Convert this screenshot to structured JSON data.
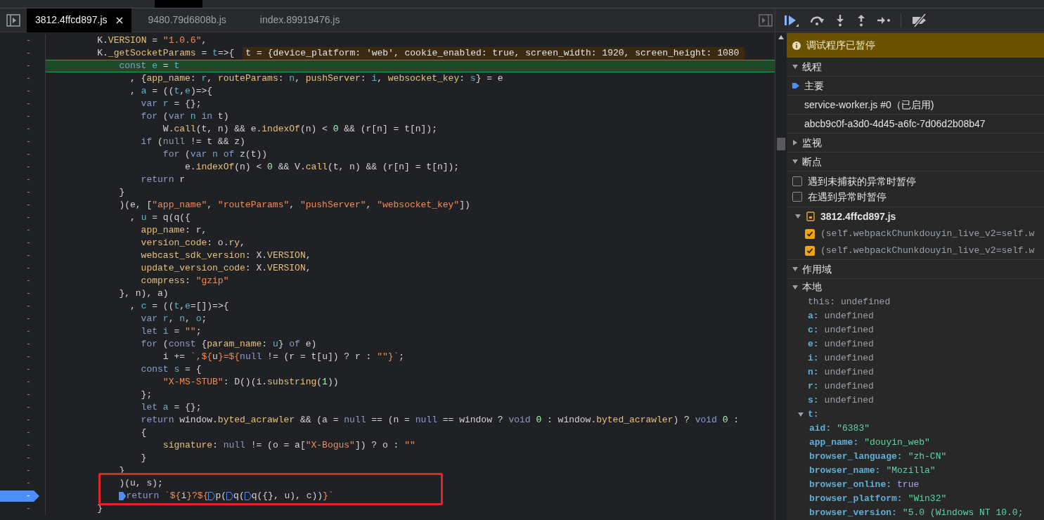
{
  "file_tabs": [
    {
      "label": "3812.4ffcd897.js",
      "selected": true,
      "closable": true
    },
    {
      "label": "9480.79d6808b.js",
      "selected": false,
      "closable": false
    },
    {
      "label": "index.89919476.js",
      "selected": false,
      "closable": false
    }
  ],
  "code": {
    "lines": [
      {
        "gutter": "-",
        "tokens": [
          {
            "text": "         K.",
            "kind": "plain"
          },
          {
            "text": "VERSION",
            "kind": "property"
          },
          {
            "text": " = ",
            "kind": "plain"
          },
          {
            "text": "\"1.0.6\"",
            "kind": "string"
          },
          {
            "text": ",",
            "kind": "plain"
          }
        ]
      },
      {
        "gutter": "-",
        "tokens": [
          {
            "text": "         K.",
            "kind": "plain"
          },
          {
            "text": "_getSocketParams",
            "kind": "property"
          },
          {
            "text": " = ",
            "kind": "plain"
          },
          {
            "text": "t",
            "kind": "variable"
          },
          {
            "text": "=>{",
            "kind": "plain"
          }
        ],
        "inline_value": "t = {device_platform: 'web', cookie_enabled: true, screen_width: 1920, screen_height: 1080"
      },
      {
        "gutter": "-",
        "current": true,
        "tokens": [
          {
            "text": "             const",
            "kind": "keyword"
          },
          {
            "text": " e",
            "kind": "variable"
          },
          {
            "text": " = ",
            "kind": "plain"
          },
          {
            "text": "t",
            "kind": "variable"
          }
        ]
      },
      {
        "gutter": "-",
        "tokens": [
          {
            "text": "               , {",
            "kind": "plain"
          },
          {
            "text": "app_name",
            "kind": "property"
          },
          {
            "text": ": ",
            "kind": "plain"
          },
          {
            "text": "r",
            "kind": "variable"
          },
          {
            "text": ", ",
            "kind": "plain"
          },
          {
            "text": "routeParams",
            "kind": "property"
          },
          {
            "text": ": ",
            "kind": "plain"
          },
          {
            "text": "n",
            "kind": "variable"
          },
          {
            "text": ", ",
            "kind": "plain"
          },
          {
            "text": "pushServer",
            "kind": "property"
          },
          {
            "text": ": ",
            "kind": "plain"
          },
          {
            "text": "i",
            "kind": "variable"
          },
          {
            "text": ", ",
            "kind": "plain"
          },
          {
            "text": "websocket_key",
            "kind": "property"
          },
          {
            "text": ": ",
            "kind": "plain"
          },
          {
            "text": "s",
            "kind": "variable"
          },
          {
            "text": "} = e",
            "kind": "plain"
          }
        ]
      },
      {
        "gutter": "-",
        "tokens": [
          {
            "text": "               , ",
            "kind": "plain"
          },
          {
            "text": "a",
            "kind": "variable"
          },
          {
            "text": " = ((",
            "kind": "plain"
          },
          {
            "text": "t",
            "kind": "variable"
          },
          {
            "text": ",",
            "kind": "plain"
          },
          {
            "text": "e",
            "kind": "variable"
          },
          {
            "text": ")=>{",
            "kind": "plain"
          }
        ]
      },
      {
        "gutter": "-",
        "tokens": [
          {
            "text": "                 var",
            "kind": "keyword"
          },
          {
            "text": " r",
            "kind": "variable"
          },
          {
            "text": " = {};",
            "kind": "plain"
          }
        ]
      },
      {
        "gutter": "-",
        "tokens": [
          {
            "text": "                 for",
            "kind": "keyword"
          },
          {
            "text": " (",
            "kind": "plain"
          },
          {
            "text": "var",
            "kind": "keyword"
          },
          {
            "text": " n",
            "kind": "variable"
          },
          {
            "text": " in",
            "kind": "keyword"
          },
          {
            "text": " t)",
            "kind": "plain"
          }
        ]
      },
      {
        "gutter": "-",
        "tokens": [
          {
            "text": "                     W.",
            "kind": "plain"
          },
          {
            "text": "call",
            "kind": "property"
          },
          {
            "text": "(t, n) && e.",
            "kind": "plain"
          },
          {
            "text": "indexOf",
            "kind": "property"
          },
          {
            "text": "(n) < ",
            "kind": "plain"
          },
          {
            "text": "0",
            "kind": "number"
          },
          {
            "text": " && (r[n] = t[n]);",
            "kind": "plain"
          }
        ]
      },
      {
        "gutter": "-",
        "tokens": [
          {
            "text": "                 if",
            "kind": "keyword"
          },
          {
            "text": " (",
            "kind": "plain"
          },
          {
            "text": "null",
            "kind": "keyword"
          },
          {
            "text": " != t && z)",
            "kind": "plain"
          }
        ]
      },
      {
        "gutter": "-",
        "tokens": [
          {
            "text": "                     for",
            "kind": "keyword"
          },
          {
            "text": " (",
            "kind": "plain"
          },
          {
            "text": "var",
            "kind": "keyword"
          },
          {
            "text": " n",
            "kind": "variable"
          },
          {
            "text": " of",
            "kind": "keyword"
          },
          {
            "text": " z(t))",
            "kind": "plain"
          }
        ]
      },
      {
        "gutter": "-",
        "tokens": [
          {
            "text": "                         e.",
            "kind": "plain"
          },
          {
            "text": "indexOf",
            "kind": "property"
          },
          {
            "text": "(n) < ",
            "kind": "plain"
          },
          {
            "text": "0",
            "kind": "number"
          },
          {
            "text": " && V.",
            "kind": "plain"
          },
          {
            "text": "call",
            "kind": "property"
          },
          {
            "text": "(t, n) && (r[n] = t[n]);",
            "kind": "plain"
          }
        ]
      },
      {
        "gutter": "-",
        "tokens": [
          {
            "text": "                 return",
            "kind": "keyword"
          },
          {
            "text": " r",
            "kind": "plain"
          }
        ]
      },
      {
        "gutter": "-",
        "tokens": [
          {
            "text": "             }",
            "kind": "plain"
          }
        ]
      },
      {
        "gutter": "-",
        "tokens": [
          {
            "text": "             )(e, [",
            "kind": "plain"
          },
          {
            "text": "\"app_name\"",
            "kind": "string"
          },
          {
            "text": ", ",
            "kind": "plain"
          },
          {
            "text": "\"routeParams\"",
            "kind": "string"
          },
          {
            "text": ", ",
            "kind": "plain"
          },
          {
            "text": "\"pushServer\"",
            "kind": "string"
          },
          {
            "text": ", ",
            "kind": "plain"
          },
          {
            "text": "\"websocket_key\"",
            "kind": "string"
          },
          {
            "text": "])",
            "kind": "plain"
          }
        ]
      },
      {
        "gutter": "-",
        "tokens": [
          {
            "text": "               , ",
            "kind": "plain"
          },
          {
            "text": "u",
            "kind": "variable"
          },
          {
            "text": " = q(q({",
            "kind": "plain"
          }
        ]
      },
      {
        "gutter": "-",
        "tokens": [
          {
            "text": "                 app_name",
            "kind": "property"
          },
          {
            "text": ": r,",
            "kind": "plain"
          }
        ]
      },
      {
        "gutter": "-",
        "tokens": [
          {
            "text": "                 version_code",
            "kind": "property"
          },
          {
            "text": ": o.",
            "kind": "plain"
          },
          {
            "text": "ry",
            "kind": "property"
          },
          {
            "text": ",",
            "kind": "plain"
          }
        ]
      },
      {
        "gutter": "-",
        "tokens": [
          {
            "text": "                 webcast_sdk_version",
            "kind": "property"
          },
          {
            "text": ": X.",
            "kind": "plain"
          },
          {
            "text": "VERSION",
            "kind": "property"
          },
          {
            "text": ",",
            "kind": "plain"
          }
        ]
      },
      {
        "gutter": "-",
        "tokens": [
          {
            "text": "                 update_version_code",
            "kind": "property"
          },
          {
            "text": ": X.",
            "kind": "plain"
          },
          {
            "text": "VERSION",
            "kind": "property"
          },
          {
            "text": ",",
            "kind": "plain"
          }
        ]
      },
      {
        "gutter": "-",
        "tokens": [
          {
            "text": "                 compress",
            "kind": "property"
          },
          {
            "text": ": ",
            "kind": "plain"
          },
          {
            "text": "\"gzip\"",
            "kind": "string"
          }
        ]
      },
      {
        "gutter": "-",
        "tokens": [
          {
            "text": "             }, n), a)",
            "kind": "plain"
          }
        ]
      },
      {
        "gutter": "-",
        "tokens": [
          {
            "text": "               , ",
            "kind": "plain"
          },
          {
            "text": "c",
            "kind": "variable"
          },
          {
            "text": " = ((",
            "kind": "plain"
          },
          {
            "text": "t",
            "kind": "variable"
          },
          {
            "text": ",",
            "kind": "plain"
          },
          {
            "text": "e",
            "kind": "variable"
          },
          {
            "text": "=[])=>{",
            "kind": "plain"
          }
        ]
      },
      {
        "gutter": "-",
        "tokens": [
          {
            "text": "                 var",
            "kind": "keyword"
          },
          {
            "text": " r",
            "kind": "variable"
          },
          {
            "text": ", ",
            "kind": "plain"
          },
          {
            "text": "n",
            "kind": "variable"
          },
          {
            "text": ", ",
            "kind": "plain"
          },
          {
            "text": "o",
            "kind": "variable"
          },
          {
            "text": ";",
            "kind": "plain"
          }
        ]
      },
      {
        "gutter": "-",
        "tokens": [
          {
            "text": "                 let",
            "kind": "keyword"
          },
          {
            "text": " i",
            "kind": "variable"
          },
          {
            "text": " = ",
            "kind": "plain"
          },
          {
            "text": "\"\"",
            "kind": "string"
          },
          {
            "text": ";",
            "kind": "plain"
          }
        ]
      },
      {
        "gutter": "-",
        "tokens": [
          {
            "text": "                 for",
            "kind": "keyword"
          },
          {
            "text": " (",
            "kind": "plain"
          },
          {
            "text": "const",
            "kind": "keyword"
          },
          {
            "text": " {",
            "kind": "plain"
          },
          {
            "text": "param_name",
            "kind": "property"
          },
          {
            "text": ": ",
            "kind": "plain"
          },
          {
            "text": "u",
            "kind": "variable"
          },
          {
            "text": "} ",
            "kind": "plain"
          },
          {
            "text": "of",
            "kind": "keyword"
          },
          {
            "text": " e)",
            "kind": "plain"
          }
        ]
      },
      {
        "gutter": "-",
        "tokens": [
          {
            "text": "                     i += ",
            "kind": "plain"
          },
          {
            "text": "`,${",
            "kind": "string"
          },
          {
            "text": "u",
            "kind": "plain"
          },
          {
            "text": "}=${",
            "kind": "string"
          },
          {
            "text": "null",
            "kind": "keyword"
          },
          {
            "text": " != (r = t[u]) ? r : ",
            "kind": "plain"
          },
          {
            "text": "\"\"",
            "kind": "string"
          },
          {
            "text": "}`",
            "kind": "string"
          },
          {
            "text": ";",
            "kind": "plain"
          }
        ]
      },
      {
        "gutter": "-",
        "tokens": [
          {
            "text": "                 const",
            "kind": "keyword"
          },
          {
            "text": " s",
            "kind": "variable"
          },
          {
            "text": " = {",
            "kind": "plain"
          }
        ]
      },
      {
        "gutter": "-",
        "tokens": [
          {
            "text": "                     \"X-MS-STUB\"",
            "kind": "string"
          },
          {
            "text": ": D()(i.",
            "kind": "plain"
          },
          {
            "text": "substring",
            "kind": "property"
          },
          {
            "text": "(",
            "kind": "plain"
          },
          {
            "text": "1",
            "kind": "number"
          },
          {
            "text": "))",
            "kind": "plain"
          }
        ]
      },
      {
        "gutter": "-",
        "tokens": [
          {
            "text": "                 };",
            "kind": "plain"
          }
        ]
      },
      {
        "gutter": "-",
        "tokens": [
          {
            "text": "                 let",
            "kind": "keyword"
          },
          {
            "text": " a",
            "kind": "variable"
          },
          {
            "text": " = {};",
            "kind": "plain"
          }
        ]
      },
      {
        "gutter": "-",
        "tokens": [
          {
            "text": "                 return",
            "kind": "keyword"
          },
          {
            "text": " window.",
            "kind": "plain"
          },
          {
            "text": "byted_acrawler",
            "kind": "property"
          },
          {
            "text": " && (a = ",
            "kind": "plain"
          },
          {
            "text": "null",
            "kind": "keyword"
          },
          {
            "text": " == (n = ",
            "kind": "plain"
          },
          {
            "text": "null",
            "kind": "keyword"
          },
          {
            "text": " == window ? ",
            "kind": "plain"
          },
          {
            "text": "void",
            "kind": "keyword"
          },
          {
            "text": " 0",
            "kind": "number"
          },
          {
            "text": " : window.",
            "kind": "plain"
          },
          {
            "text": "byted_acrawler",
            "kind": "property"
          },
          {
            "text": ") ? ",
            "kind": "plain"
          },
          {
            "text": "void",
            "kind": "keyword"
          },
          {
            "text": " 0",
            "kind": "number"
          },
          {
            "text": " :",
            "kind": "plain"
          }
        ]
      },
      {
        "gutter": "-",
        "tokens": [
          {
            "text": "                 {",
            "kind": "plain"
          }
        ]
      },
      {
        "gutter": "-",
        "tokens": [
          {
            "text": "                     signature",
            "kind": "property"
          },
          {
            "text": ": ",
            "kind": "plain"
          },
          {
            "text": "null",
            "kind": "keyword"
          },
          {
            "text": " != (o = a[",
            "kind": "plain"
          },
          {
            "text": "\"X-Bogus\"",
            "kind": "string"
          },
          {
            "text": "]) ? o : ",
            "kind": "plain"
          },
          {
            "text": "\"\"",
            "kind": "string"
          }
        ]
      },
      {
        "gutter": "-",
        "tokens": [
          {
            "text": "                 }",
            "kind": "plain"
          }
        ]
      },
      {
        "gutter": "-",
        "tokens": [
          {
            "text": "             }",
            "kind": "plain"
          }
        ]
      },
      {
        "gutter": "-",
        "boxed": true,
        "tokens": [
          {
            "text": "             )(u, s);",
            "kind": "plain"
          }
        ]
      },
      {
        "gutter": "-",
        "boxed": true,
        "breakpoint": true,
        "tokens": [
          {
            "kind": "marker",
            "on": true
          },
          {
            "text": "return",
            "kind": "keyword"
          },
          {
            "text": " `${",
            "kind": "string"
          },
          {
            "text": "i",
            "kind": "plain"
          },
          {
            "text": "}?${",
            "kind": "string"
          },
          {
            "kind": "marker",
            "on": false
          },
          {
            "text": "p(",
            "kind": "plain"
          },
          {
            "kind": "marker",
            "on": false
          },
          {
            "text": "q(",
            "kind": "plain"
          },
          {
            "kind": "marker",
            "on": false
          },
          {
            "text": "q({}, u), c))",
            "kind": "plain"
          },
          {
            "text": "}`",
            "kind": "string"
          }
        ]
      },
      {
        "gutter": "-",
        "tokens": [
          {
            "text": "         }",
            "kind": "plain"
          }
        ]
      }
    ]
  },
  "paused_banner": "调试程序已暂停",
  "threads": {
    "label": "线程",
    "expanded": true,
    "items": [
      {
        "label": "主要",
        "selected": true
      },
      {
        "label": "service-worker.js #0（已启用)",
        "selected": false
      },
      {
        "label": "abcb9c0f-a3d0-4d45-a6fc-7d06d2b08b47",
        "selected": false
      }
    ]
  },
  "watch": {
    "label": "监视",
    "expanded": false
  },
  "breakpoints": {
    "label": "断点",
    "expanded": true,
    "options": [
      {
        "label": "遇到未捕获的异常时暂停",
        "checked": false
      },
      {
        "label": "在遇到异常时暂停",
        "checked": false
      }
    ],
    "files": [
      {
        "name": "3812.4ffcd897.js",
        "expanded": true,
        "items": [
          {
            "code": "(self.webpackChunkdouyin_live_v2=self.w",
            "checked": true
          },
          {
            "code": "(self.webpackChunkdouyin_live_v2=self.w",
            "checked": true
          }
        ]
      }
    ]
  },
  "scope": {
    "label": "作用域",
    "expanded": true,
    "groups": [
      {
        "label": "本地",
        "expanded": true,
        "vars": [
          {
            "name": "this:",
            "value": "undefined",
            "kind": "unset",
            "dim": true
          },
          {
            "name": "a:",
            "value": "undefined",
            "kind": "unset",
            "dim": false
          },
          {
            "name": "c:",
            "value": "undefined",
            "kind": "unset",
            "dim": false
          },
          {
            "name": "e:",
            "value": "undefined",
            "kind": "unset",
            "dim": false
          },
          {
            "name": "i:",
            "value": "undefined",
            "kind": "unset",
            "dim": false
          },
          {
            "name": "n:",
            "value": "undefined",
            "kind": "unset",
            "dim": false
          },
          {
            "name": "r:",
            "value": "undefined",
            "kind": "unset",
            "dim": false
          },
          {
            "name": "s:",
            "value": "undefined",
            "kind": "unset",
            "dim": false
          },
          {
            "name": "t:",
            "dim": false,
            "expanded": true,
            "children": [
              {
                "name": "aid:",
                "value": "\"6383\"",
                "kind": "string",
                "dim": false
              },
              {
                "name": "app_name:",
                "value": "\"douyin_web\"",
                "kind": "string",
                "dim": false
              },
              {
                "name": "browser_language:",
                "value": "\"zh-CN\"",
                "kind": "string",
                "dim": false
              },
              {
                "name": "browser_name:",
                "value": "\"Mozilla\"",
                "kind": "string",
                "dim": false
              },
              {
                "name": "browser_online:",
                "value": "true",
                "kind": "boolean",
                "dim": false
              },
              {
                "name": "browser_platform:",
                "value": "\"Win32\"",
                "kind": "string",
                "dim": false
              },
              {
                "name": "browser_version:",
                "value": "\"5.0 (Windows NT 10.0;",
                "kind": "string",
                "dim": false
              }
            ]
          }
        ]
      }
    ]
  }
}
